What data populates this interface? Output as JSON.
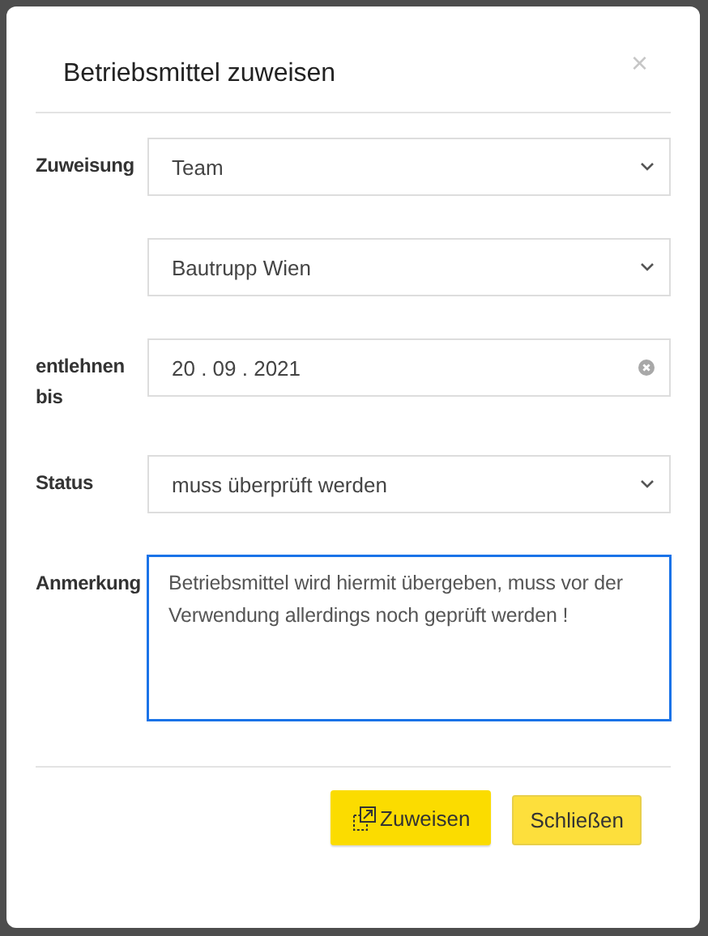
{
  "dialog": {
    "title": "Betriebsmittel zuweisen",
    "close": "×"
  },
  "fields": [
    {
      "kind": "select",
      "label": "Zuweisung",
      "value": "Team",
      "focused": false
    },
    {
      "kind": "select",
      "value": "Bautrupp Wien",
      "focused": false
    },
    {
      "kind": "date",
      "label": "entlehnen bis",
      "value": "20 . 09 . 2021",
      "focused": false
    },
    {
      "kind": "select",
      "label": "Status",
      "value": "muss überprüft werden",
      "focused": false
    },
    {
      "kind": "textarea",
      "label": "Anmerkung",
      "value": "Betriebsmittel wird hiermit übergeben, muss vor der Verwendung allerdings noch geprüft werden !",
      "focused": true
    }
  ],
  "buttons": [
    {
      "kind": "primary",
      "label": "Zuweisen"
    },
    {
      "kind": "secondary",
      "label": "Schließen"
    }
  ]
}
